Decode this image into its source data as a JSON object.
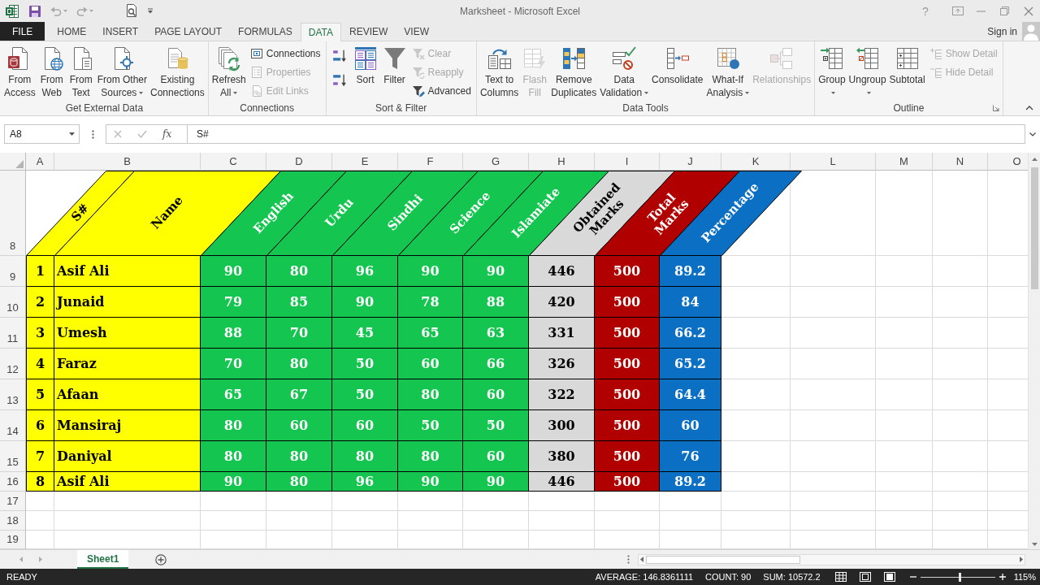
{
  "window": {
    "title": "Marksheet - Microsoft Excel",
    "help": "?"
  },
  "ribbon_tabs": [
    {
      "label": "FILE",
      "kind": "file",
      "selected": false
    },
    {
      "label": "HOME",
      "kind": "tab",
      "selected": false
    },
    {
      "label": "INSERT",
      "kind": "tab",
      "selected": false
    },
    {
      "label": "PAGE LAYOUT",
      "kind": "tab",
      "selected": false
    },
    {
      "label": "FORMULAS",
      "kind": "tab",
      "selected": false
    },
    {
      "label": "DATA",
      "kind": "tab",
      "selected": true
    },
    {
      "label": "REVIEW",
      "kind": "tab",
      "selected": false
    },
    {
      "label": "VIEW",
      "kind": "tab",
      "selected": false
    }
  ],
  "account": {
    "label": "Sign in"
  },
  "ribbon_groups": [
    {
      "title": "Get External Data",
      "columns": [
        [
          {
            "label": "From Access",
            "kind": "large",
            "menu": false,
            "disabled": false
          }
        ],
        [
          {
            "label": "From Web",
            "kind": "large",
            "menu": false,
            "disabled": false
          }
        ],
        [
          {
            "label": "From Text",
            "kind": "large",
            "menu": false,
            "disabled": false
          }
        ],
        [
          {
            "label": "From Other Sources",
            "kind": "large",
            "menu": true,
            "disabled": false
          }
        ],
        [
          {
            "label": "Existing Connections",
            "kind": "large",
            "menu": false,
            "disabled": false
          }
        ]
      ]
    },
    {
      "title": "Connections",
      "columns": [
        [
          {
            "label": "Refresh All",
            "kind": "large",
            "menu": true,
            "disabled": false
          }
        ],
        [
          {
            "label": "Connections",
            "kind": "small",
            "menu": false,
            "disabled": false
          },
          {
            "label": "Properties",
            "kind": "small",
            "menu": false,
            "disabled": true
          },
          {
            "label": "Edit Links",
            "kind": "small",
            "menu": false,
            "disabled": true
          }
        ]
      ]
    },
    {
      "title": "Sort & Filter",
      "columns": [
        [
          {
            "kind": "icon",
            "disabled": false
          },
          {
            "kind": "icon",
            "disabled": false
          }
        ],
        [
          {
            "label": "Sort",
            "kind": "large",
            "menu": false,
            "disabled": false
          }
        ],
        [
          {
            "label": "Filter",
            "kind": "large",
            "menu": false,
            "disabled": false
          }
        ],
        [
          {
            "label": "Clear",
            "kind": "small",
            "menu": false,
            "disabled": true
          },
          {
            "label": "Reapply",
            "kind": "small",
            "menu": false,
            "disabled": true
          },
          {
            "label": "Advanced",
            "kind": "small",
            "menu": false,
            "disabled": false
          }
        ]
      ]
    },
    {
      "title": "Data Tools",
      "columns": [
        [
          {
            "label": "Text to Columns",
            "kind": "large",
            "menu": false,
            "disabled": false
          }
        ],
        [
          {
            "label": "Flash Fill",
            "kind": "large",
            "menu": false,
            "disabled": true
          }
        ],
        [
          {
            "label": "Remove Duplicates",
            "kind": "large",
            "menu": false,
            "disabled": false
          }
        ],
        [
          {
            "label": "Data Validation",
            "kind": "large",
            "menu": true,
            "disabled": false
          }
        ],
        [
          {
            "label": "Consolidate",
            "kind": "large",
            "menu": false,
            "disabled": false
          }
        ],
        [
          {
            "label": "What-If Analysis",
            "kind": "large",
            "menu": true,
            "disabled": false
          }
        ],
        [
          {
            "label": "Relationships",
            "kind": "large",
            "menu": false,
            "disabled": true
          }
        ]
      ]
    },
    {
      "title": "Outline",
      "launcher": true,
      "columns": [
        [
          {
            "label": "Group",
            "kind": "large",
            "menu": true,
            "disabled": false
          }
        ],
        [
          {
            "label": "Ungroup",
            "kind": "large",
            "menu": true,
            "disabled": false
          }
        ],
        [
          {
            "label": "Subtotal",
            "kind": "large",
            "menu": false,
            "disabled": false
          }
        ],
        [
          {
            "label": "Show Detail",
            "kind": "small",
            "menu": false,
            "disabled": true
          },
          {
            "label": "Hide Detail",
            "kind": "small",
            "menu": false,
            "disabled": true
          }
        ]
      ]
    }
  ],
  "formula_bar": {
    "name_box": "A8",
    "insert_function": "fx",
    "formula": "S#"
  },
  "sheet": {
    "columns": [
      "A",
      "B",
      "C",
      "D",
      "E",
      "F",
      "G",
      "H",
      "I",
      "J",
      "K",
      "L",
      "M",
      "N",
      "O"
    ],
    "rows": [
      "8",
      "9",
      "10",
      "11",
      "12",
      "13",
      "14",
      "15",
      "16",
      "17",
      "18",
      "19"
    ],
    "headers": [
      {
        "text": "S#",
        "color": "#ffff00"
      },
      {
        "text": "Name",
        "color": "#ffff00"
      },
      {
        "text": "English",
        "color": "#14c650"
      },
      {
        "text": "Urdu",
        "color": "#14c650"
      },
      {
        "text": "Sindhi",
        "color": "#14c650"
      },
      {
        "text": "Science",
        "color": "#14c650"
      },
      {
        "text": "Islamiate",
        "color": "#14c650"
      },
      {
        "text": "Obtained Marks",
        "color": "#d9d9d9"
      },
      {
        "text": "Total Marks",
        "color": "#b00000"
      },
      {
        "text": "Percentage",
        "color": "#0b6fc4"
      }
    ],
    "records": [
      [
        "1",
        "Asif Ali",
        "90",
        "80",
        "96",
        "90",
        "90",
        "446",
        "500",
        "89.2"
      ],
      [
        "2",
        "Junaid",
        "79",
        "85",
        "90",
        "78",
        "88",
        "420",
        "500",
        "84"
      ],
      [
        "3",
        "Umesh",
        "88",
        "70",
        "45",
        "65",
        "63",
        "331",
        "500",
        "66.2"
      ],
      [
        "4",
        "Faraz",
        "70",
        "80",
        "50",
        "60",
        "66",
        "326",
        "500",
        "65.2"
      ],
      [
        "5",
        "Afaan",
        "65",
        "67",
        "50",
        "80",
        "60",
        "322",
        "500",
        "64.4"
      ],
      [
        "6",
        "Mansiraj",
        "80",
        "60",
        "60",
        "50",
        "50",
        "300",
        "500",
        "60"
      ],
      [
        "7",
        "Daniyal",
        "80",
        "80",
        "80",
        "80",
        "60",
        "380",
        "500",
        "76"
      ],
      [
        "8",
        "Asif Ali",
        "90",
        "80",
        "96",
        "90",
        "90",
        "446",
        "500",
        "89.2"
      ]
    ]
  },
  "sheet_tabs": [
    {
      "label": "Sheet1",
      "selected": true
    }
  ],
  "status_bar": {
    "mode": "READY",
    "average": "AVERAGE: 146.8361111",
    "count": "COUNT: 90",
    "sum": "SUM: 10572.2",
    "zoom": {
      "level": 0.53,
      "reading": "115%"
    }
  }
}
